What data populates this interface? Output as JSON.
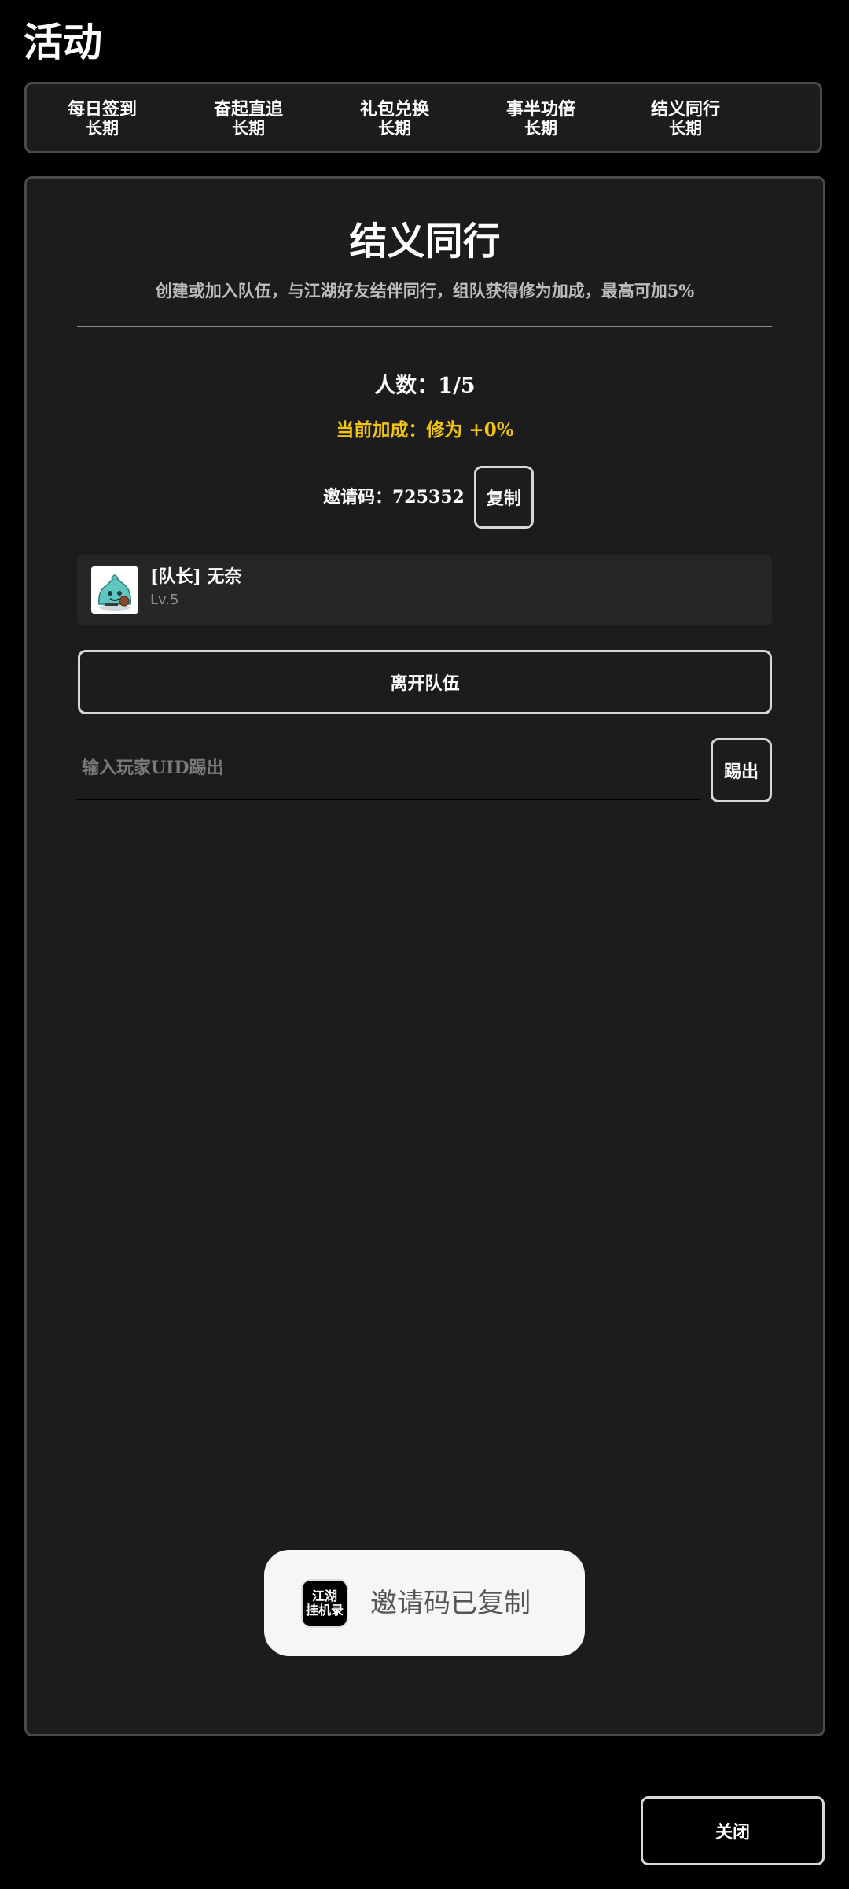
{
  "page": {
    "title": "活动"
  },
  "tabs": [
    {
      "label": "每日签到",
      "sub": "长期"
    },
    {
      "label": "奋起直追",
      "sub": "长期"
    },
    {
      "label": "礼包兑换",
      "sub": "长期"
    },
    {
      "label": "事半功倍",
      "sub": "长期"
    },
    {
      "label": "结义同行",
      "sub": "长期",
      "active": true
    }
  ],
  "panel": {
    "title": "结义同行",
    "description": "创建或加入队伍，与江湖好友结伴同行，组队获得修为加成，最高可加5%",
    "member_count": "人数：1/5",
    "bonus": "当前加成：修为 +0%",
    "invite_code": "邀请码：725352",
    "copy_label": "复制",
    "members": [
      {
        "name": "[队长] 无奈",
        "level": "Lv.5"
      }
    ],
    "leave_label": "离开队伍",
    "kick_placeholder": "输入玩家UID踢出",
    "kick_label": "踢出"
  },
  "toast": {
    "icon_line1": "江湖",
    "icon_line2": "挂机录",
    "message": "邀请码已复制"
  },
  "footer": {
    "close_label": "关闭"
  },
  "colors": {
    "accent": "#1a8fe3",
    "bonus": "#f1c40f",
    "panel_bg": "#1c1c1c",
    "border": "#4a4a4a"
  }
}
